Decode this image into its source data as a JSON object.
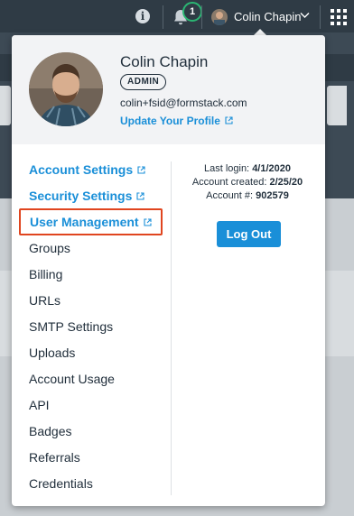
{
  "topbar": {
    "info_icon": "info-icon",
    "bell_icon": "bell-icon",
    "notification_count": "1",
    "user_name": "Colin Chapin",
    "chevron_icon": "chevron-down-icon",
    "apps_icon": "grid-icon"
  },
  "profile": {
    "name": "Colin Chapin",
    "role": "ADMIN",
    "email": "colin+fsid@formstack.com",
    "update_link": "Update Your Profile",
    "external_icon": "external-link-icon"
  },
  "menu": {
    "items": [
      {
        "label": "Account Settings",
        "link": true
      },
      {
        "label": "Security Settings",
        "link": true
      },
      {
        "label": "User Management",
        "link": true,
        "highlighted": true
      },
      {
        "label": "Groups"
      },
      {
        "label": "Billing"
      },
      {
        "label": "URLs"
      },
      {
        "label": "SMTP Settings"
      },
      {
        "label": "Uploads"
      },
      {
        "label": "Account Usage"
      },
      {
        "label": "API"
      },
      {
        "label": "Badges"
      },
      {
        "label": "Referrals"
      },
      {
        "label": "Credentials"
      }
    ]
  },
  "account": {
    "last_login_label": "Last login:",
    "last_login": "4/1/2020",
    "created_label": "Account created:",
    "created": "2/25/20",
    "number_label": "Account #:",
    "number": "902579"
  },
  "logout_label": "Log Out",
  "colors": {
    "link": "#1a8fd8",
    "highlight_border": "#e0451f",
    "badge_ring": "#2bb673",
    "nav_bg": "#2f3b45"
  }
}
